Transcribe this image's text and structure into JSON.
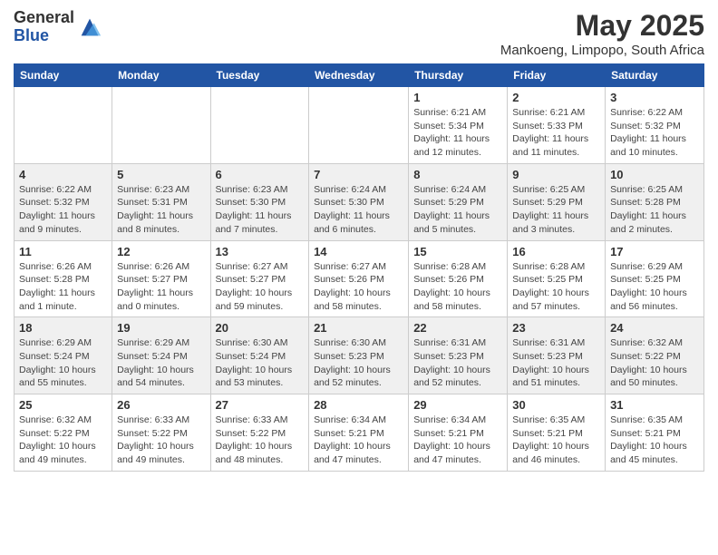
{
  "logo": {
    "general": "General",
    "blue": "Blue"
  },
  "title": "May 2025",
  "subtitle": "Mankoeng, Limpopo, South Africa",
  "days_of_week": [
    "Sunday",
    "Monday",
    "Tuesday",
    "Wednesday",
    "Thursday",
    "Friday",
    "Saturday"
  ],
  "weeks": [
    [
      {
        "day": "",
        "detail": ""
      },
      {
        "day": "",
        "detail": ""
      },
      {
        "day": "",
        "detail": ""
      },
      {
        "day": "",
        "detail": ""
      },
      {
        "day": "1",
        "detail": "Sunrise: 6:21 AM\nSunset: 5:34 PM\nDaylight: 11 hours and 12 minutes."
      },
      {
        "day": "2",
        "detail": "Sunrise: 6:21 AM\nSunset: 5:33 PM\nDaylight: 11 hours and 11 minutes."
      },
      {
        "day": "3",
        "detail": "Sunrise: 6:22 AM\nSunset: 5:32 PM\nDaylight: 11 hours and 10 minutes."
      }
    ],
    [
      {
        "day": "4",
        "detail": "Sunrise: 6:22 AM\nSunset: 5:32 PM\nDaylight: 11 hours and 9 minutes."
      },
      {
        "day": "5",
        "detail": "Sunrise: 6:23 AM\nSunset: 5:31 PM\nDaylight: 11 hours and 8 minutes."
      },
      {
        "day": "6",
        "detail": "Sunrise: 6:23 AM\nSunset: 5:30 PM\nDaylight: 11 hours and 7 minutes."
      },
      {
        "day": "7",
        "detail": "Sunrise: 6:24 AM\nSunset: 5:30 PM\nDaylight: 11 hours and 6 minutes."
      },
      {
        "day": "8",
        "detail": "Sunrise: 6:24 AM\nSunset: 5:29 PM\nDaylight: 11 hours and 5 minutes."
      },
      {
        "day": "9",
        "detail": "Sunrise: 6:25 AM\nSunset: 5:29 PM\nDaylight: 11 hours and 3 minutes."
      },
      {
        "day": "10",
        "detail": "Sunrise: 6:25 AM\nSunset: 5:28 PM\nDaylight: 11 hours and 2 minutes."
      }
    ],
    [
      {
        "day": "11",
        "detail": "Sunrise: 6:26 AM\nSunset: 5:28 PM\nDaylight: 11 hours and 1 minute."
      },
      {
        "day": "12",
        "detail": "Sunrise: 6:26 AM\nSunset: 5:27 PM\nDaylight: 11 hours and 0 minutes."
      },
      {
        "day": "13",
        "detail": "Sunrise: 6:27 AM\nSunset: 5:27 PM\nDaylight: 10 hours and 59 minutes."
      },
      {
        "day": "14",
        "detail": "Sunrise: 6:27 AM\nSunset: 5:26 PM\nDaylight: 10 hours and 58 minutes."
      },
      {
        "day": "15",
        "detail": "Sunrise: 6:28 AM\nSunset: 5:26 PM\nDaylight: 10 hours and 58 minutes."
      },
      {
        "day": "16",
        "detail": "Sunrise: 6:28 AM\nSunset: 5:25 PM\nDaylight: 10 hours and 57 minutes."
      },
      {
        "day": "17",
        "detail": "Sunrise: 6:29 AM\nSunset: 5:25 PM\nDaylight: 10 hours and 56 minutes."
      }
    ],
    [
      {
        "day": "18",
        "detail": "Sunrise: 6:29 AM\nSunset: 5:24 PM\nDaylight: 10 hours and 55 minutes."
      },
      {
        "day": "19",
        "detail": "Sunrise: 6:29 AM\nSunset: 5:24 PM\nDaylight: 10 hours and 54 minutes."
      },
      {
        "day": "20",
        "detail": "Sunrise: 6:30 AM\nSunset: 5:24 PM\nDaylight: 10 hours and 53 minutes."
      },
      {
        "day": "21",
        "detail": "Sunrise: 6:30 AM\nSunset: 5:23 PM\nDaylight: 10 hours and 52 minutes."
      },
      {
        "day": "22",
        "detail": "Sunrise: 6:31 AM\nSunset: 5:23 PM\nDaylight: 10 hours and 52 minutes."
      },
      {
        "day": "23",
        "detail": "Sunrise: 6:31 AM\nSunset: 5:23 PM\nDaylight: 10 hours and 51 minutes."
      },
      {
        "day": "24",
        "detail": "Sunrise: 6:32 AM\nSunset: 5:22 PM\nDaylight: 10 hours and 50 minutes."
      }
    ],
    [
      {
        "day": "25",
        "detail": "Sunrise: 6:32 AM\nSunset: 5:22 PM\nDaylight: 10 hours and 49 minutes."
      },
      {
        "day": "26",
        "detail": "Sunrise: 6:33 AM\nSunset: 5:22 PM\nDaylight: 10 hours and 49 minutes."
      },
      {
        "day": "27",
        "detail": "Sunrise: 6:33 AM\nSunset: 5:22 PM\nDaylight: 10 hours and 48 minutes."
      },
      {
        "day": "28",
        "detail": "Sunrise: 6:34 AM\nSunset: 5:21 PM\nDaylight: 10 hours and 47 minutes."
      },
      {
        "day": "29",
        "detail": "Sunrise: 6:34 AM\nSunset: 5:21 PM\nDaylight: 10 hours and 47 minutes."
      },
      {
        "day": "30",
        "detail": "Sunrise: 6:35 AM\nSunset: 5:21 PM\nDaylight: 10 hours and 46 minutes."
      },
      {
        "day": "31",
        "detail": "Sunrise: 6:35 AM\nSunset: 5:21 PM\nDaylight: 10 hours and 45 minutes."
      }
    ]
  ]
}
